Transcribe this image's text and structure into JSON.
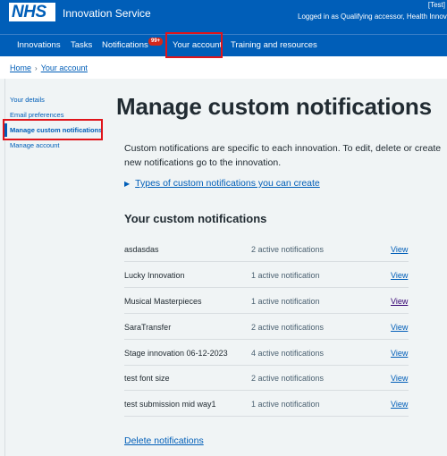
{
  "header": {
    "logo_text": "NHS",
    "service_name": "Innovation Service",
    "env_tag": "[Test]",
    "logged_in": "Logged in as Qualifying accessor, Health Innovation"
  },
  "nav": {
    "items": [
      {
        "label": "Innovations"
      },
      {
        "label": "Tasks"
      },
      {
        "label": "Notifications"
      },
      {
        "label": "Your account"
      },
      {
        "label": "Training and resources"
      }
    ],
    "notifications_badge": "99+"
  },
  "breadcrumb": {
    "home": "Home",
    "current": "Your account"
  },
  "sidebar": {
    "items": [
      {
        "label": "Your details"
      },
      {
        "label": "Email preferences"
      },
      {
        "label": "Manage custom notifications"
      },
      {
        "label": "Manage account"
      }
    ]
  },
  "main": {
    "title": "Manage custom notifications",
    "intro": "Custom notifications are specific to each innovation. To edit, delete or create new notifications go to the innovation.",
    "details_label": "Types of custom notifications you can create",
    "section_title": "Your custom notifications",
    "rows": [
      {
        "name": "asdasdas",
        "count": "2 active notifications",
        "action": "View"
      },
      {
        "name": "Lucky Innovation",
        "count": "1 active notification",
        "action": "View"
      },
      {
        "name": "Musical Masterpieces",
        "count": "1 active notification",
        "action": "View"
      },
      {
        "name": "SaraTransfer",
        "count": "2 active notifications",
        "action": "View"
      },
      {
        "name": "Stage innovation 06-12-2023",
        "count": "4 active notifications",
        "action": "View"
      },
      {
        "name": "test font size",
        "count": "2 active notifications",
        "action": "View"
      },
      {
        "name": "test submission mid way1",
        "count": "1 active notification",
        "action": "View"
      }
    ],
    "delete_label": "Delete notifications"
  },
  "colors": {
    "nhs_blue": "#005eb8",
    "highlight_red": "#e0141a",
    "badge_red": "#d5281b",
    "background_grey": "#f0f4f5"
  }
}
